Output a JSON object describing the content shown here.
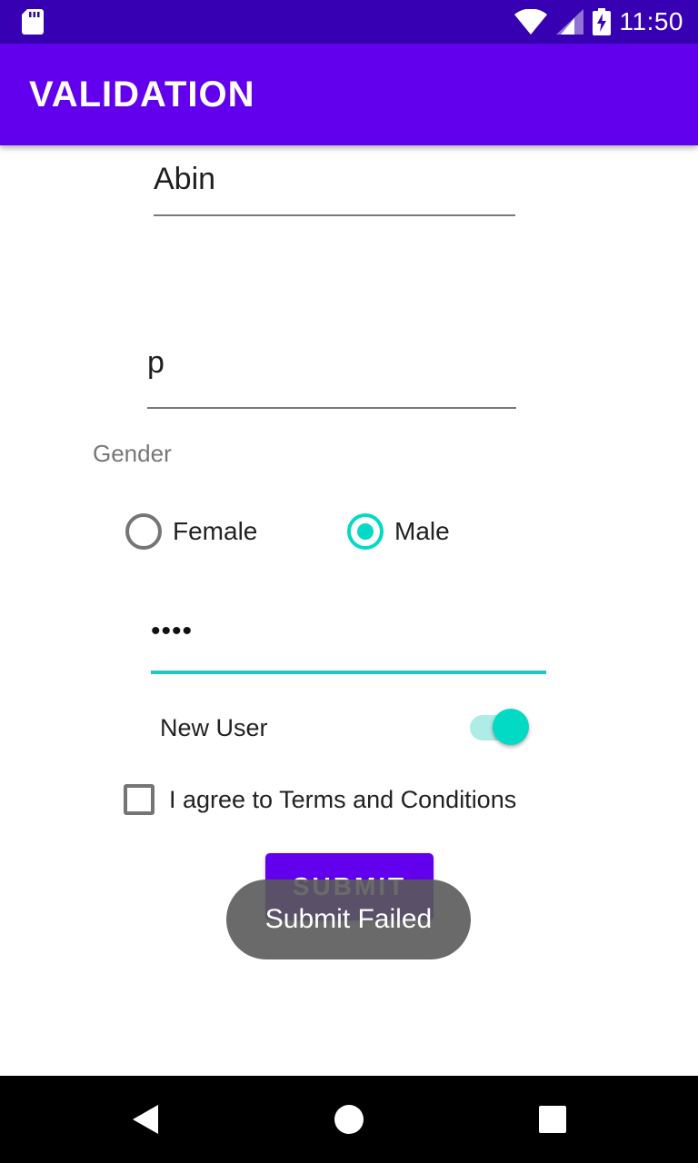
{
  "status_bar": {
    "time": "11:50",
    "icons": [
      "sd-card-icon",
      "wifi-icon",
      "signal-icon",
      "battery-charging-icon"
    ],
    "background": "#3700b3"
  },
  "app_bar": {
    "title": "VALIDATION",
    "background": "#6200ee"
  },
  "form": {
    "name_value": "Abin",
    "second_value": "p",
    "gender_label": "Gender",
    "gender_options": [
      "Female",
      "Male"
    ],
    "gender_selected": "Male",
    "password_value": "••••",
    "new_user_label": "New User",
    "new_user_on": true,
    "terms_label": "I agree to Terms and Conditions",
    "terms_checked": false,
    "submit_label": "SUBMIT",
    "accent_color": "#03dac5"
  },
  "toast": {
    "message": "Submit Failed"
  },
  "nav_bar": {
    "buttons": [
      "back-icon",
      "home-icon",
      "recents-icon"
    ]
  }
}
